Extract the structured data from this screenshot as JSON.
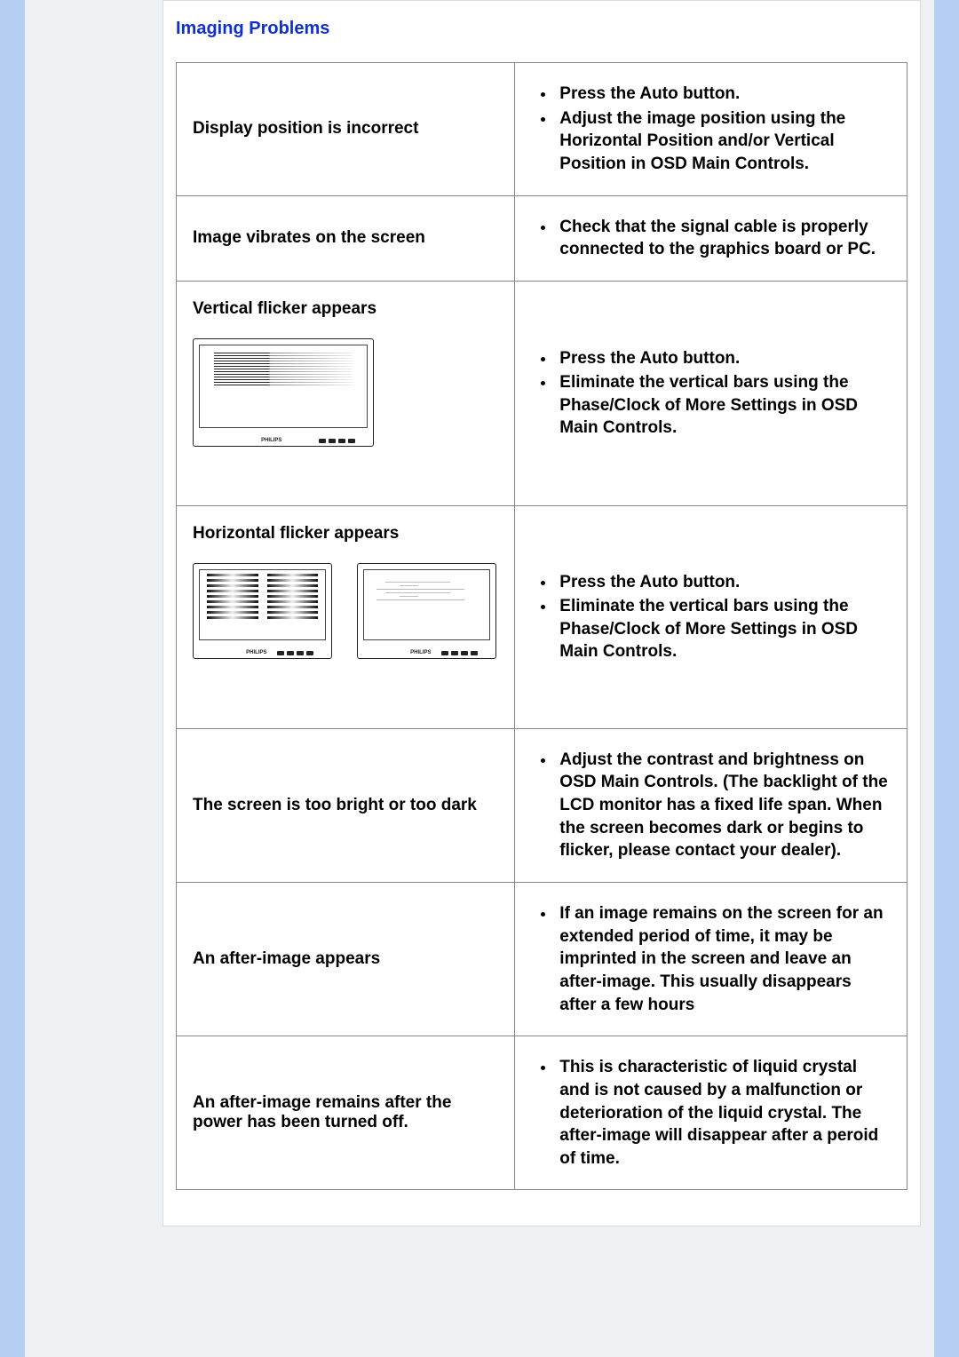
{
  "section_title": "Imaging Problems",
  "rows": [
    {
      "problem": "Display position is incorrect",
      "sol": [
        "Press the Auto button.",
        "Adjust the image position using the Horizontal Position and/or Vertical Position in OSD Main Controls."
      ]
    },
    {
      "problem": "Image vibrates on the screen",
      "sol": [
        "Check that the signal cable is properly connected to the graphics board or PC."
      ]
    },
    {
      "problem": "Vertical flicker appears",
      "sol": [
        "Press the Auto button.",
        "Eliminate the vertical bars using the Phase/Clock of More Settings in OSD Main Controls."
      ]
    },
    {
      "problem": "Horizontal flicker appears",
      "sol": [
        "Press the Auto button.",
        "Eliminate the vertical bars using the Phase/Clock of More Settings in OSD Main Controls."
      ]
    },
    {
      "problem": "The screen is too bright or too dark",
      "sol": [
        "Adjust the contrast and brightness on OSD Main Controls. (The backlight of the LCD monitor has a fixed life span. When the screen becomes dark or begins to flicker, please contact your dealer)."
      ]
    },
    {
      "problem": "An after-image appears",
      "sol": [
        "If an image remains on the screen for an extended period of time, it may be imprinted in the screen and leave an after-image. This usually disappears after a few hours"
      ]
    },
    {
      "problem": "An after-image remains after the power has been turned off.",
      "sol": [
        "This is characteristic of liquid crystal and is not caused by a malfunction or deterioration of the liquid crystal. The after-image will disappear after a peroid of time."
      ]
    }
  ]
}
